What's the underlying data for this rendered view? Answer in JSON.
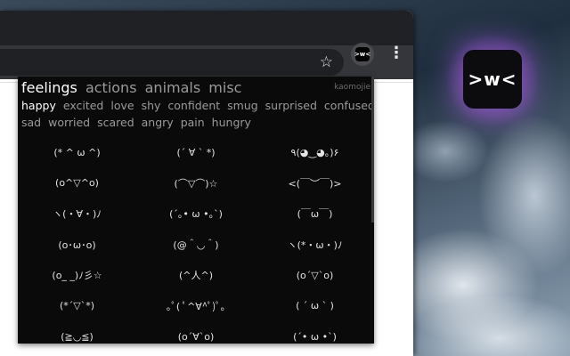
{
  "app_icon": {
    "label": ">w<"
  },
  "toolbar": {
    "extension_label": ">w<"
  },
  "popup": {
    "brand": "kaomojie",
    "categories": [
      "feelings",
      "actions",
      "animals",
      "misc"
    ],
    "active_category": "feelings",
    "subcategories_row1": [
      "happy",
      "excited",
      "love",
      "shy",
      "confident",
      "smug",
      "surprised",
      "confused"
    ],
    "subcategories_row2": [
      "sad",
      "worried",
      "scared",
      "angry",
      "pain",
      "hungry"
    ],
    "active_subcategory": "happy",
    "kaomoji": [
      "(* ^ ω ^)",
      "(´ ∀ ` *)",
      "٩(◕‿◕｡)۶",
      "(o^▽^o)",
      "(⌒▽⌒)☆",
      "<(￣︶￣)>",
      "ヽ(・∀・)ﾉ",
      "(´｡• ω •｡`)",
      "(￣ω￣)",
      "(o･ω･o)",
      "(@＾◡＾)",
      "ヽ(*・ω・)ﾉ",
      "(o_ _)ﾉ彡☆",
      "(^人^)",
      "(o´▽`o)",
      "(*´▽`*)",
      "｡ﾟ( ﾟ^∀^ﾟ)ﾟ｡",
      "( ´ ω ` )",
      "(≧◡≦)",
      "(o´∀`o)",
      "(´• ω •`)"
    ]
  },
  "colors": {
    "popup_bg": "#0a0a0a",
    "active_text": "#ffffff",
    "inactive_text": "#9a9a9a",
    "toolbar_bg": "#35363a",
    "accent_glow": "#aa5ae6"
  }
}
